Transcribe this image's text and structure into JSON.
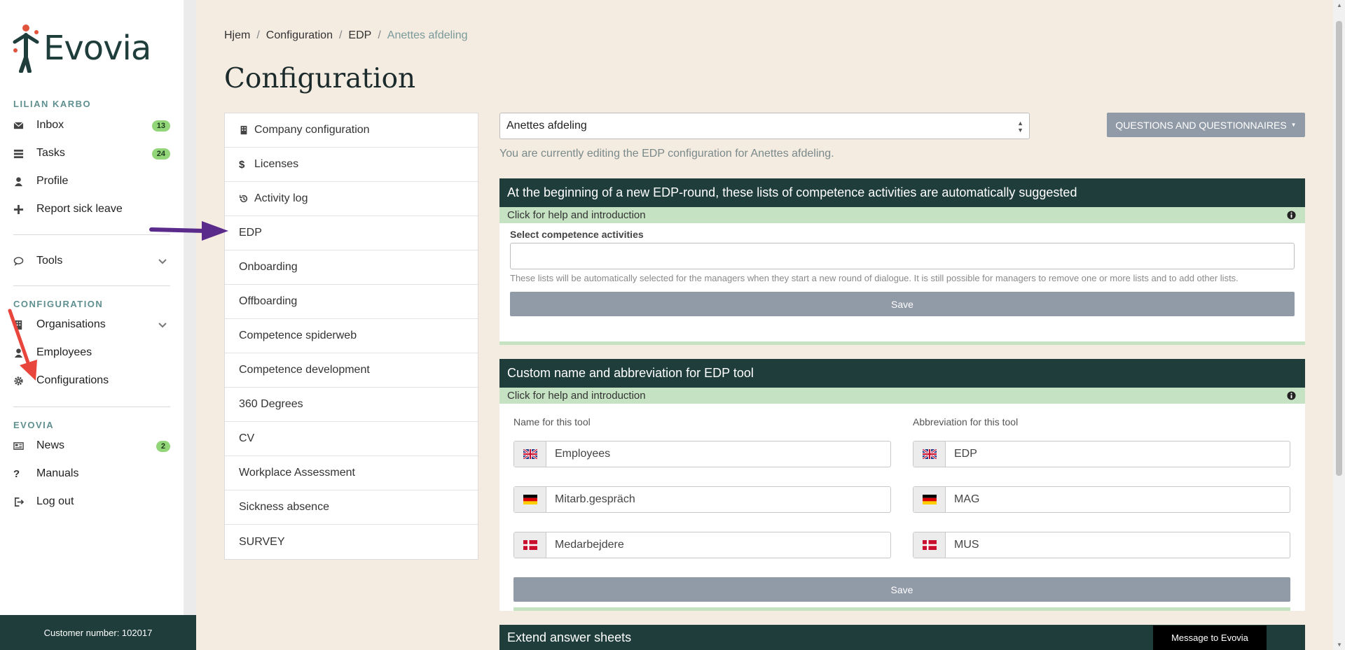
{
  "app": {
    "brand": "Evovia",
    "customer_label": "Customer number: 102017"
  },
  "sidebar": {
    "user_section": "LILIAN KARBO",
    "user_items": [
      {
        "label": "Inbox",
        "icon": "envelope-icon",
        "badge": "13"
      },
      {
        "label": "Tasks",
        "icon": "tasks-icon",
        "badge": "24"
      },
      {
        "label": "Profile",
        "icon": "user-icon"
      },
      {
        "label": "Report sick leave",
        "icon": "plus-icon"
      }
    ],
    "tools": {
      "label": "Tools",
      "icon": "comment-icon"
    },
    "config_section": "CONFIGURATION",
    "config_items": [
      {
        "label": "Organisations",
        "icon": "building-icon"
      },
      {
        "label": "Employees",
        "icon": "user-icon"
      },
      {
        "label": "Configurations",
        "icon": "gear-icon"
      }
    ],
    "evovia_section": "EVOVIA",
    "evovia_items": [
      {
        "label": "News",
        "icon": "newspaper-icon",
        "badge": "2"
      },
      {
        "label": "Manuals",
        "icon": "question-icon"
      },
      {
        "label": "Log out",
        "icon": "sign-out-icon"
      }
    ]
  },
  "breadcrumb": [
    "Hjem",
    "Configuration",
    "EDP",
    "Anettes afdeling"
  ],
  "page_title": "Configuration",
  "config_menu": [
    {
      "label": "Company configuration",
      "icon": "building-icon"
    },
    {
      "label": "Licenses",
      "icon": "dollar-icon"
    },
    {
      "label": "Activity log",
      "icon": "history-icon"
    },
    {
      "label": "EDP"
    },
    {
      "label": "Onboarding"
    },
    {
      "label": "Offboarding"
    },
    {
      "label": "Competence spiderweb"
    },
    {
      "label": "Competence development"
    },
    {
      "label": "360 Degrees"
    },
    {
      "label": "CV"
    },
    {
      "label": "Workplace Assessment"
    },
    {
      "label": "Sickness absence"
    },
    {
      "label": "SURVEY"
    }
  ],
  "department_select": {
    "value": "Anettes afdeling"
  },
  "questions_button": "QUESTIONS AND QUESTIONNAIRES",
  "editing_note": "You are currently editing the EDP configuration for Anettes afdeling.",
  "card1": {
    "title": "At the beginning of a new EDP-round, these lists of competence activities are automatically suggested",
    "help": "Click for help and introduction",
    "field_label": "Select competence activities",
    "note": "These lists will be automatically selected for the managers when they start a new round of dialogue. It is still possible for managers to remove one or more lists and to add other lists.",
    "save": "Save"
  },
  "card2": {
    "title": "Custom name and abbreviation for EDP tool",
    "help": "Click for help and introduction",
    "name_label": "Name for this tool",
    "abbr_label": "Abbreviation for this tool",
    "names": [
      {
        "flag": "uk-flag-icon",
        "value": "Employees"
      },
      {
        "flag": "de-flag-icon",
        "value": "Mitarb.gespräch"
      },
      {
        "flag": "dk-flag-icon",
        "value": "Medarbejdere"
      }
    ],
    "abbrs": [
      {
        "flag": "uk-flag-icon",
        "value": "EDP"
      },
      {
        "flag": "de-flag-icon",
        "value": "MAG"
      },
      {
        "flag": "dk-flag-icon",
        "value": "MUS"
      }
    ],
    "save": "Save"
  },
  "card3": {
    "title": "Extend answer sheets"
  },
  "message_button": "Message to Evovia",
  "colors": {
    "dark_teal": "#1e3d3b",
    "help_green": "#c5e2c3",
    "button_grey": "#919aa7",
    "badge_green": "#93d67a",
    "page_bg": "#f4ebe1",
    "arrow_purple": "#5b2b8c",
    "arrow_red": "#e8453c"
  }
}
